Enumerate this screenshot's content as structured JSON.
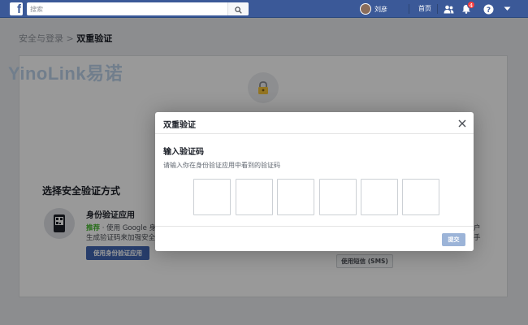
{
  "topbar": {
    "logo": "f",
    "search_placeholder": "搜索",
    "user_name": "刘彦",
    "home_label": "首页",
    "notification_count": "4",
    "icons": [
      "search-icon",
      "friends-icon",
      "messenger-icon",
      "notifications-icon",
      "help-icon",
      "caret-down-icon"
    ]
  },
  "breadcrumb": {
    "parent": "安全与登录",
    "separator": ">",
    "current": "双重验证"
  },
  "watermark": "YinoLink易诺",
  "page": {
    "section_title": "选择安全验证方式",
    "method_title": "身份验证应用",
    "method_desc_recommend": "推荐",
    "method_desc_line1": " · 使用 Google 身",
    "method_desc_line2": "生成验证码来加强安全",
    "use_app_button": "使用身份验证应用",
    "right_fragment1": "户",
    "right_fragment2": "手",
    "sms_button": "使用短信 (SMS)"
  },
  "modal": {
    "title": "双重验证",
    "heading": "输入验证码",
    "hint": "请输入你在身份验证应用中看到的验证码",
    "digits": [
      "",
      "",
      "",
      "",
      "",
      ""
    ],
    "submit_label": "提交"
  },
  "colors": {
    "header": "#3b5998",
    "primary_button": "#4267b2",
    "recommend": "#42b72a",
    "disabled_button": "#9cb4d8"
  }
}
